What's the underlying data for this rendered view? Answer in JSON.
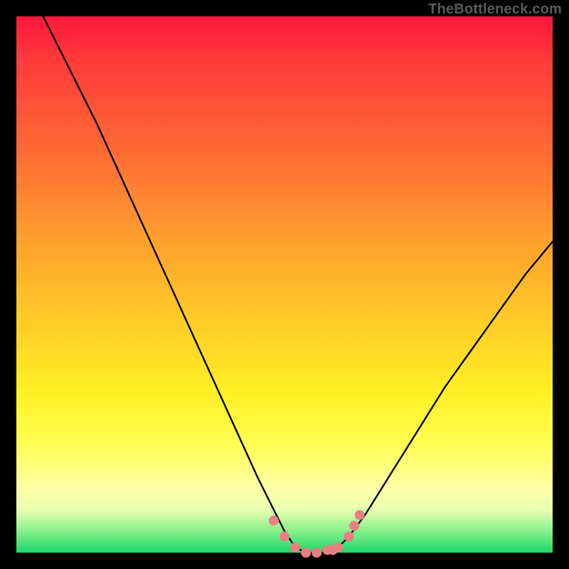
{
  "watermark": "TheBottleneck.com",
  "chart_data": {
    "type": "line",
    "title": "",
    "xlabel": "",
    "ylabel": "",
    "xlim": [
      0,
      100
    ],
    "ylim": [
      0,
      100
    ],
    "curve": {
      "name": "bottleneck-curve",
      "description": "V-shaped bottleneck curve with flat minimum near zero",
      "x": [
        5,
        10,
        15,
        20,
        25,
        30,
        35,
        40,
        45,
        48,
        50,
        52,
        54,
        56,
        58,
        60,
        62,
        65,
        70,
        75,
        80,
        85,
        90,
        95,
        100
      ],
      "y": [
        100,
        90,
        80,
        69,
        58,
        47,
        36,
        25,
        14,
        8,
        4,
        1,
        0,
        0,
        0,
        1,
        3,
        7,
        15,
        23,
        31,
        38,
        45,
        52,
        58
      ]
    },
    "markers": {
      "name": "highlight-points",
      "description": "Pink marker points along bottom of V",
      "x": [
        48,
        50,
        52,
        54,
        56,
        58,
        59,
        60,
        62,
        63,
        64
      ],
      "y": [
        6,
        3,
        1,
        0,
        0,
        0.5,
        0.5,
        1,
        3,
        5,
        7
      ],
      "color": "#e98080",
      "radius_px": 7
    },
    "gradient_stops": [
      {
        "pos": 0.0,
        "color": "#ff173e"
      },
      {
        "pos": 0.25,
        "color": "#ff6a34"
      },
      {
        "pos": 0.55,
        "color": "#ffc728"
      },
      {
        "pos": 0.8,
        "color": "#ffff55"
      },
      {
        "pos": 0.92,
        "color": "#e8ffb0"
      },
      {
        "pos": 1.0,
        "color": "#1ad86a"
      }
    ]
  }
}
